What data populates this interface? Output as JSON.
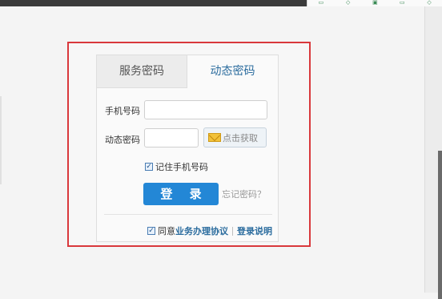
{
  "tabs": [
    {
      "label": "服务密码",
      "active": false
    },
    {
      "label": "动态密码",
      "active": true
    }
  ],
  "form": {
    "phone_label": "手机号码",
    "phone_value": "",
    "code_label": "动态密码",
    "code_value": "",
    "get_code_label": "点击获取",
    "remember_label": "记住手机号码",
    "remember_checked": true,
    "login_label": "登 录",
    "forgot_label": "忘记密码？"
  },
  "footer": {
    "agree_prefix": "同意",
    "agreement_link": "业务办理协议",
    "login_help_link": "登录说明",
    "agree_checked": true
  },
  "colors": {
    "accent": "#2387d6",
    "tab_active_text": "#2b6c9e",
    "highlight_border": "#d9383c"
  }
}
